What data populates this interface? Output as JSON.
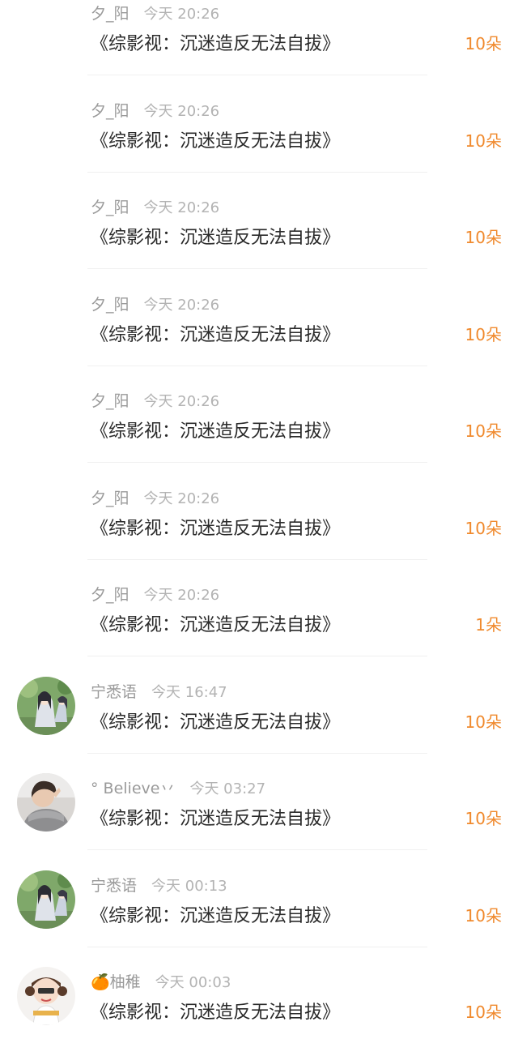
{
  "rows": [
    {
      "user": "夕_阳",
      "time": "今天 20:26",
      "title": "《综影视：沉迷造反无法自拔》",
      "amount": "10朵",
      "avatar": "none"
    },
    {
      "user": "夕_阳",
      "time": "今天 20:26",
      "title": "《综影视：沉迷造反无法自拔》",
      "amount": "10朵",
      "avatar": "none"
    },
    {
      "user": "夕_阳",
      "time": "今天 20:26",
      "title": "《综影视：沉迷造反无法自拔》",
      "amount": "10朵",
      "avatar": "none"
    },
    {
      "user": "夕_阳",
      "time": "今天 20:26",
      "title": "《综影视：沉迷造反无法自拔》",
      "amount": "10朵",
      "avatar": "none"
    },
    {
      "user": "夕_阳",
      "time": "今天 20:26",
      "title": "《综影视：沉迷造反无法自拔》",
      "amount": "10朵",
      "avatar": "none"
    },
    {
      "user": "夕_阳",
      "time": "今天 20:26",
      "title": "《综影视：沉迷造反无法自拔》",
      "amount": "10朵",
      "avatar": "none"
    },
    {
      "user": "夕_阳",
      "time": "今天 20:26",
      "title": "《综影视：沉迷造反无法自拔》",
      "amount": "1朵",
      "avatar": "none"
    },
    {
      "user": "宁悉语",
      "time": "今天 16:47",
      "title": "《综影视：沉迷造反无法自拔》",
      "amount": "10朵",
      "avatar": "anime-avatar"
    },
    {
      "user": "° Believe丷",
      "time": "今天 03:27",
      "title": "《综影视：沉迷造反无法自拔》",
      "amount": "10朵",
      "avatar": "photo-avatar"
    },
    {
      "user": "宁悉语",
      "time": "今天 00:13",
      "title": "《综影视：沉迷造反无法自拔》",
      "amount": "10朵",
      "avatar": "anime-avatar"
    },
    {
      "user": "🍊柚稚",
      "time": "今天 00:03",
      "title": "《综影视：沉迷造反无法自拔》",
      "amount": "10朵",
      "avatar": "cartoon-avatar"
    }
  ],
  "colors": {
    "amount": "#f08a2e",
    "title": "#2a2a2a",
    "meta": "#999999"
  }
}
